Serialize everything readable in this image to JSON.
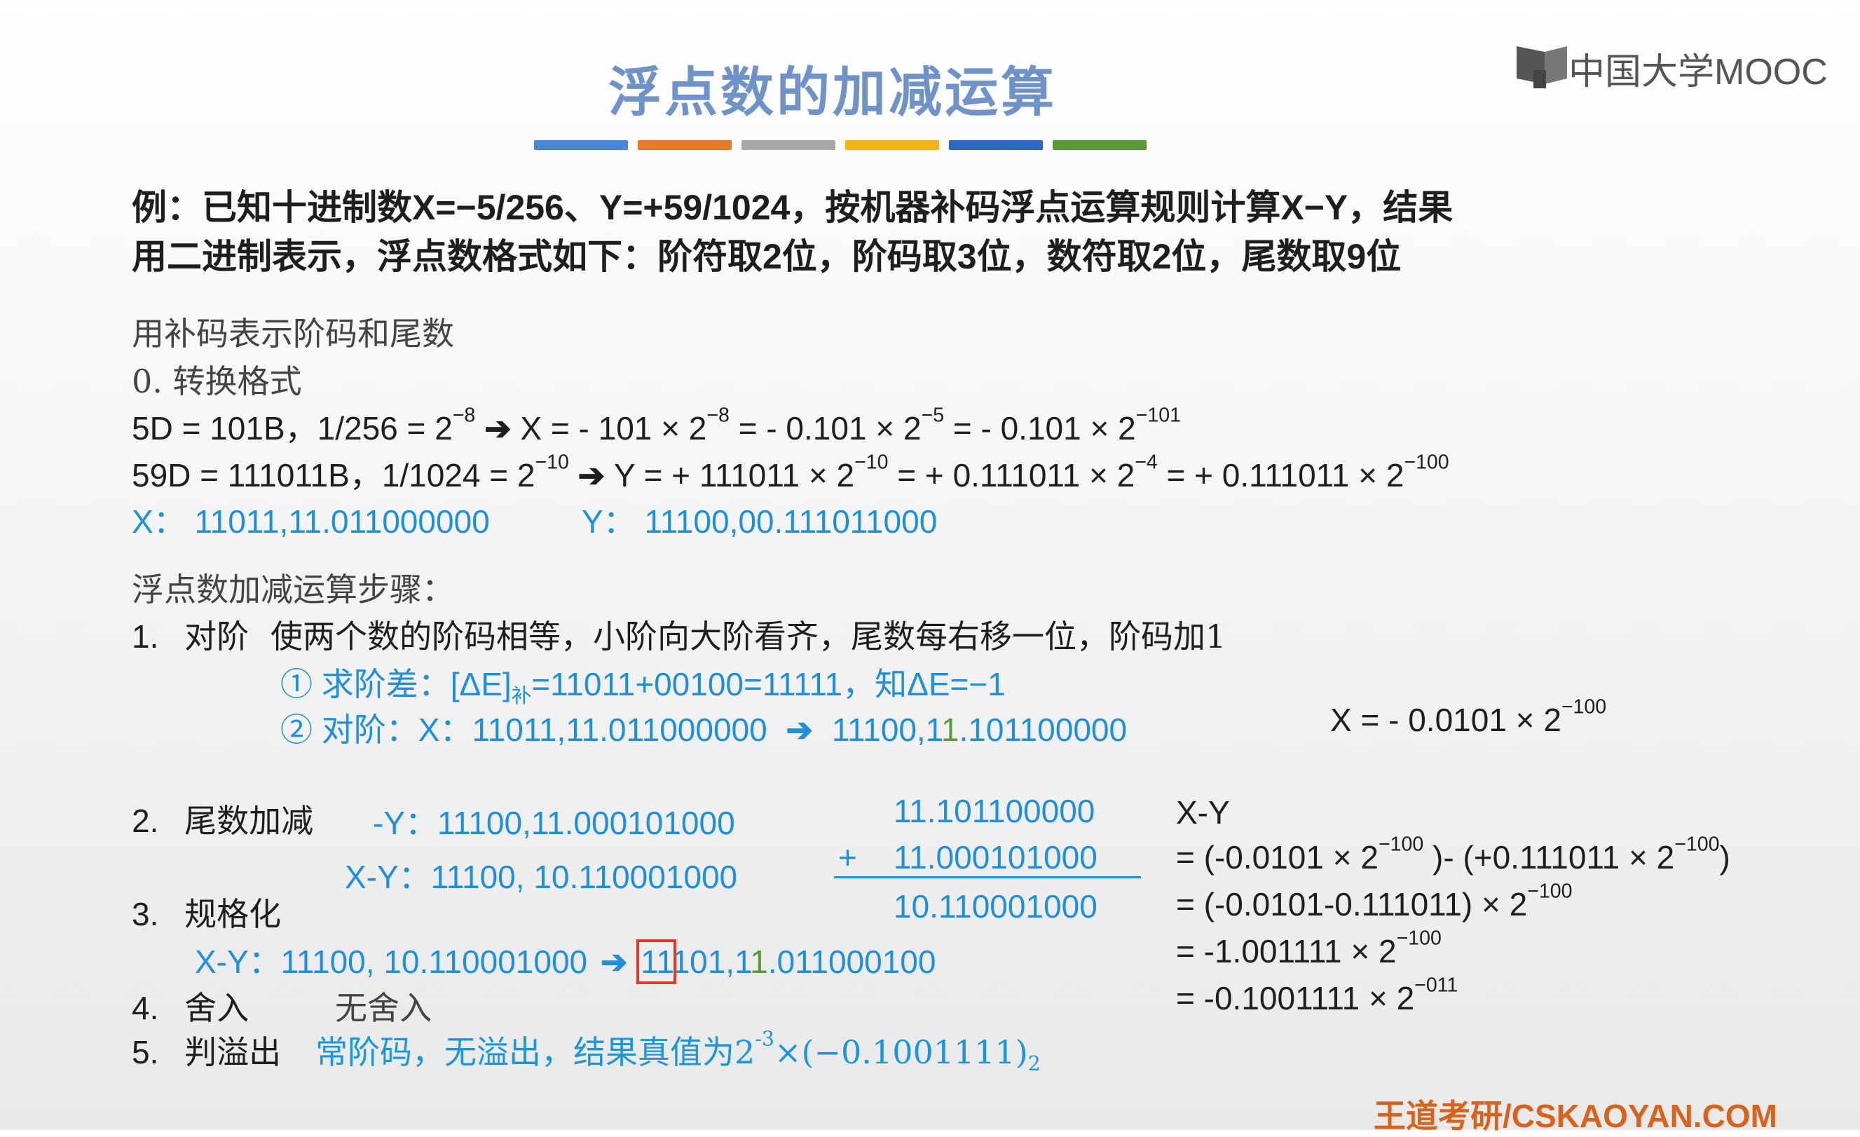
{
  "header": {
    "title": "浮点数的加减运算",
    "logo_text": "中国大学MOOC"
  },
  "bar_colors": [
    "#4b87d4",
    "#e37a2c",
    "#a8a8a8",
    "#f2b31b",
    "#2f67c2",
    "#5b9a3a"
  ],
  "problem": {
    "line1": "例：已知十进制数X=−5/256、Y=+59/1024，按机器补码浮点运算规则计算X−Y，结果",
    "line2": "用二进制表示，浮点数格式如下：阶符取2位，阶码取3位，数符取2位，尾数取9位"
  },
  "section0": {
    "heading": "用补码表示阶码和尾数",
    "step0": "0. 转换格式",
    "row1": {
      "a": "5D = 101B，1/256 = 2",
      "a_exp": "−8",
      "b": "X = - 101 × 2",
      "b_exp": "−8",
      "c": "= - 0.101 × 2",
      "c_exp": "−5",
      "d": "= - 0.101 × 2",
      "d_exp": "−101"
    },
    "row2": {
      "a": "59D = 111011B，1/1024 = 2",
      "a_exp": "−10",
      "b": "Y = + 111011 × 2",
      "b_exp": "−10",
      "c": "= + 0.111011 × 2",
      "c_exp": "−4",
      "d": "= + 0.111011 × 2",
      "d_exp": "−100"
    },
    "x_label": "X：",
    "x_value": "11011,11.011000000",
    "y_label": "Y：",
    "y_value": "11100,00.111011000"
  },
  "steps": {
    "heading": "浮点数加减运算步骤：",
    "step1": {
      "num": "1.",
      "name": "对阶",
      "desc": "使两个数的阶码相等，小阶向大阶看齐，尾数每右移一位，阶码加1",
      "sub1": "① 求阶差：[ΔE]",
      "sub1_sub": "补",
      "sub1_rest": "=11011+00100=11111，知ΔE=−1",
      "sub2": "② 对阶：X：11011,11.011000000",
      "sub2_result_a": "11100,1",
      "sub2_result_b": "1",
      "sub2_result_c": ".101100000",
      "sub2_note": "X = - 0.0101 × 2",
      "sub2_note_exp": "−100"
    },
    "step2": {
      "num": "2.",
      "name": "尾数加减",
      "neg_y": "-Y：11100,11.000101000",
      "x_minus_y": "X-Y：11100, 10.110001000",
      "add_a": "11.101100000",
      "add_plus": "+",
      "add_b": "11.000101000",
      "add_sum": "10.110001000"
    },
    "step3": {
      "num": "3.",
      "name": "规格化",
      "line_a": "X-Y：11100, 10.110001000",
      "line_b1": "11",
      "line_b2": "101,1",
      "line_b3": "1",
      "line_b4": ".011000100"
    },
    "step4": {
      "num": "4.",
      "name": "舍入",
      "value": "无舍入"
    },
    "step5": {
      "num": "5.",
      "name": "判溢出",
      "value_a": "常阶码，无溢出，结果真值为2",
      "value_exp": "-3",
      "value_b": "×(−0.1001111)",
      "value_sub": "2"
    }
  },
  "derivation": {
    "l0": "X-Y",
    "l1a": "= (-0.0101 × 2",
    "l1a_exp": "−100",
    "l1b": ")- (+0.111011 × 2",
    "l1b_exp": "−100",
    "l1c": ")",
    "l2": "= (-0.0101-0.111011) × 2",
    "l2_exp": "−100",
    "l3": "= -1.001111 × 2",
    "l3_exp": "−100",
    "l4": "= -0.1001111 × 2",
    "l4_exp": "−011"
  },
  "footer": "王道考研/CSKAOYAN.COM"
}
